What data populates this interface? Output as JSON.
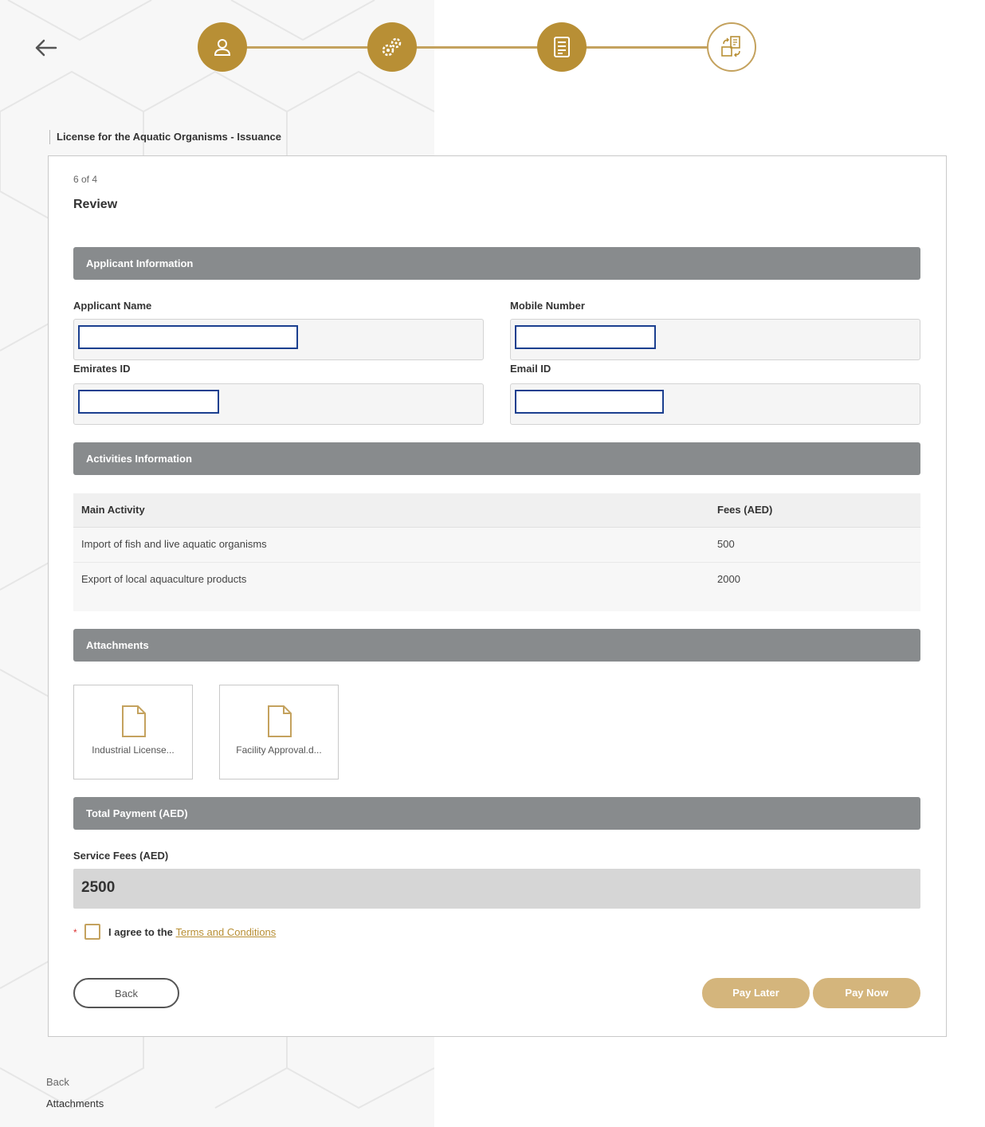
{
  "stepper": {
    "accent_color": "#b88f35",
    "steps": [
      {
        "icon": "user-icon",
        "status": "completed"
      },
      {
        "icon": "gears-icon",
        "status": "completed"
      },
      {
        "icon": "checklist-icon",
        "status": "completed"
      },
      {
        "icon": "review-exchange-icon",
        "status": "current"
      }
    ]
  },
  "header": {
    "back_icon": "arrow-left-icon",
    "service_title": "License for the Aquatic Organisms - Issuance"
  },
  "card": {
    "step_count": "6 of 4",
    "title": "Review"
  },
  "applicant": {
    "section_title": "Applicant Information",
    "name_label": "Applicant Name",
    "name_value": "",
    "mobile_label": "Mobile Number",
    "mobile_value": "",
    "emirates_label": "Emirates ID",
    "emirates_value": "",
    "email_label": "Email ID",
    "email_value": ""
  },
  "activities": {
    "section_title": "Activities Information",
    "columns": [
      "Main Activity",
      "Fees (AED)"
    ],
    "rows": [
      {
        "activity": "Import of fish and live aquatic organisms",
        "fee": "500"
      },
      {
        "activity": "Export of local aquaculture products",
        "fee": "2000"
      }
    ]
  },
  "attachments": {
    "section_title": "Attachments",
    "files": [
      {
        "name": "Industrial License...",
        "icon": "document-icon"
      },
      {
        "name": "Facility Approval.d...",
        "icon": "document-icon"
      }
    ]
  },
  "payment": {
    "section_title": "Total Payment (AED)",
    "service_fees_label": "Service Fees (AED)",
    "service_fees_value": "2500"
  },
  "terms": {
    "required_mark": "*",
    "agree_text": "I agree to the",
    "link_text": "Terms and Conditions",
    "checked": false
  },
  "actions": {
    "back_label": "Back",
    "pay_later_label": "Pay Later",
    "pay_now_label": "Pay Now"
  },
  "footer": {
    "back_link": "Back",
    "attachments_link": "Attachments"
  }
}
